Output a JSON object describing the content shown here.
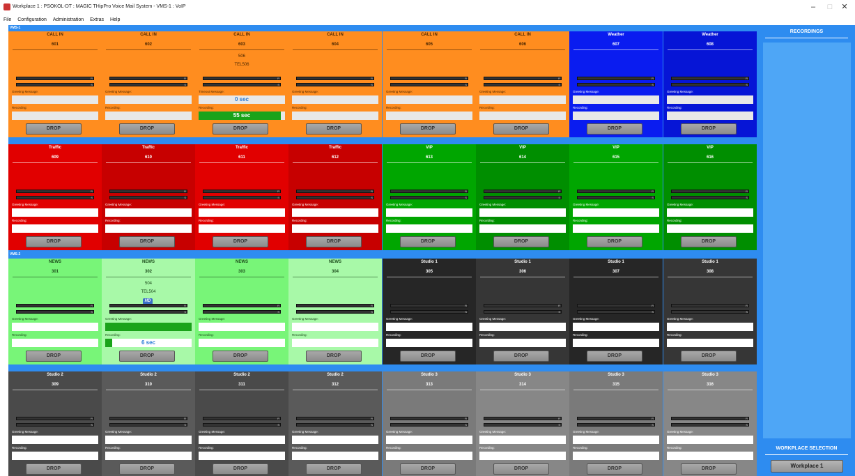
{
  "window": {
    "title": "Workplace 1 : PSOKOL-DT : MAGIC THipPro Voice Mail System - VMS-1 : VoIP",
    "minimize": "–",
    "maximize": "□",
    "close": "✕"
  },
  "menu": [
    "File",
    "Configuration",
    "Administration",
    "Extras",
    "Help"
  ],
  "groups": [
    {
      "label": "VMS-1"
    },
    {
      "label": "VMS-2"
    }
  ],
  "labels": {
    "greeting": "Greeting Message:",
    "timeout": "Timeout Message:",
    "recording": "Recording:",
    "drop": "DROP",
    "meter_r": "R",
    "meter_s": "S",
    "hd": "HD"
  },
  "panels": [
    {
      "name": "CALL IN",
      "number": "601",
      "theme": "orange"
    },
    {
      "name": "CALL IN",
      "number": "602",
      "theme": "orange"
    },
    {
      "name": "CALL IN",
      "number": "603",
      "theme": "orange",
      "caller": "506",
      "line": "TEL506",
      "message_label": "timeout",
      "message_text": "0 sec",
      "recording_text": "55 sec",
      "recording_progress": 0.95
    },
    {
      "name": "CALL IN",
      "number": "604",
      "theme": "orange"
    },
    {
      "name": "CALL IN",
      "number": "605",
      "theme": "orange"
    },
    {
      "name": "CALL IN",
      "number": "606",
      "theme": "orange"
    },
    {
      "name": "Weather",
      "number": "607",
      "theme": "blue"
    },
    {
      "name": "Weather",
      "number": "608",
      "theme": "blue2"
    },
    {
      "name": "Traffic",
      "number": "609",
      "theme": "red"
    },
    {
      "name": "Traffic",
      "number": "610",
      "theme": "red2"
    },
    {
      "name": "Traffic",
      "number": "611",
      "theme": "red"
    },
    {
      "name": "Traffic",
      "number": "612",
      "theme": "red2"
    },
    {
      "name": "VIP",
      "number": "613",
      "theme": "green"
    },
    {
      "name": "VIP",
      "number": "614",
      "theme": "green2"
    },
    {
      "name": "VIP",
      "number": "615",
      "theme": "green"
    },
    {
      "name": "VIP",
      "number": "616",
      "theme": "green2"
    },
    {
      "name": "NEWS",
      "number": "301",
      "theme": "lgreen"
    },
    {
      "name": "NEWS",
      "number": "302",
      "theme": "lgreen2",
      "caller": "504",
      "line": "TEL504",
      "hd": true,
      "message_progress": 1.0,
      "recording_text": "6 sec",
      "recording_progress": 0.08
    },
    {
      "name": "NEWS",
      "number": "303",
      "theme": "lgreen"
    },
    {
      "name": "NEWS",
      "number": "304",
      "theme": "lgreen2"
    },
    {
      "name": "Studio 1",
      "number": "305",
      "theme": "dark"
    },
    {
      "name": "Studio 1",
      "number": "306",
      "theme": "dark2"
    },
    {
      "name": "Studio 1",
      "number": "307",
      "theme": "dark"
    },
    {
      "name": "Studio 1",
      "number": "308",
      "theme": "dark2"
    },
    {
      "name": "Studio 2",
      "number": "309",
      "theme": "grey"
    },
    {
      "name": "Studio 2",
      "number": "310",
      "theme": "grey2"
    },
    {
      "name": "Studio 2",
      "number": "311",
      "theme": "grey"
    },
    {
      "name": "Studio 2",
      "number": "312",
      "theme": "grey2"
    },
    {
      "name": "Studio 3",
      "number": "313",
      "theme": "lgrey"
    },
    {
      "name": "Studio 3",
      "number": "314",
      "theme": "lgrey2"
    },
    {
      "name": "Studio 3",
      "number": "315",
      "theme": "lgrey"
    },
    {
      "name": "Studio 3",
      "number": "316",
      "theme": "lgrey2"
    }
  ],
  "themes": {
    "orange": {
      "bg": "#ff8d1f",
      "text": "#4a2600",
      "field": "#e8e8e8"
    },
    "blue": {
      "bg": "#0a1cf0",
      "text": "#ffffff",
      "field": "#e8e8e8"
    },
    "blue2": {
      "bg": "#0615d6",
      "text": "#ffffff",
      "field": "#e8e8e8"
    },
    "red": {
      "bg": "#e10000",
      "text": "#ffffff",
      "field": "#ffffff"
    },
    "red2": {
      "bg": "#c70000",
      "text": "#ffffff",
      "field": "#ffffff"
    },
    "green": {
      "bg": "#00a600",
      "text": "#ffffff",
      "field": "#ffffff"
    },
    "green2": {
      "bg": "#008e00",
      "text": "#ffffff",
      "field": "#ffffff"
    },
    "lgreen": {
      "bg": "#78f578",
      "text": "#1a4a1a",
      "field": "#ffffff"
    },
    "lgreen2": {
      "bg": "#a8f9a8",
      "text": "#1a4a1a",
      "field": "#ffffff"
    },
    "dark": {
      "bg": "#262626",
      "text": "#ffffff",
      "field": "#ffffff"
    },
    "dark2": {
      "bg": "#363636",
      "text": "#ffffff",
      "field": "#ffffff"
    },
    "grey": {
      "bg": "#4a4a4a",
      "text": "#ffffff",
      "field": "#ffffff"
    },
    "grey2": {
      "bg": "#5a5a5a",
      "text": "#ffffff",
      "field": "#ffffff"
    },
    "lgrey": {
      "bg": "#7a7a7a",
      "text": "#ffffff",
      "field": "#ffffff"
    },
    "lgrey2": {
      "bg": "#878787",
      "text": "#ffffff",
      "field": "#ffffff"
    }
  },
  "sidebar": {
    "recordings_title": "RECORDINGS",
    "workplace_selection_title": "WORKPLACE SELECTION",
    "workplace_button": "Workplace 1"
  }
}
